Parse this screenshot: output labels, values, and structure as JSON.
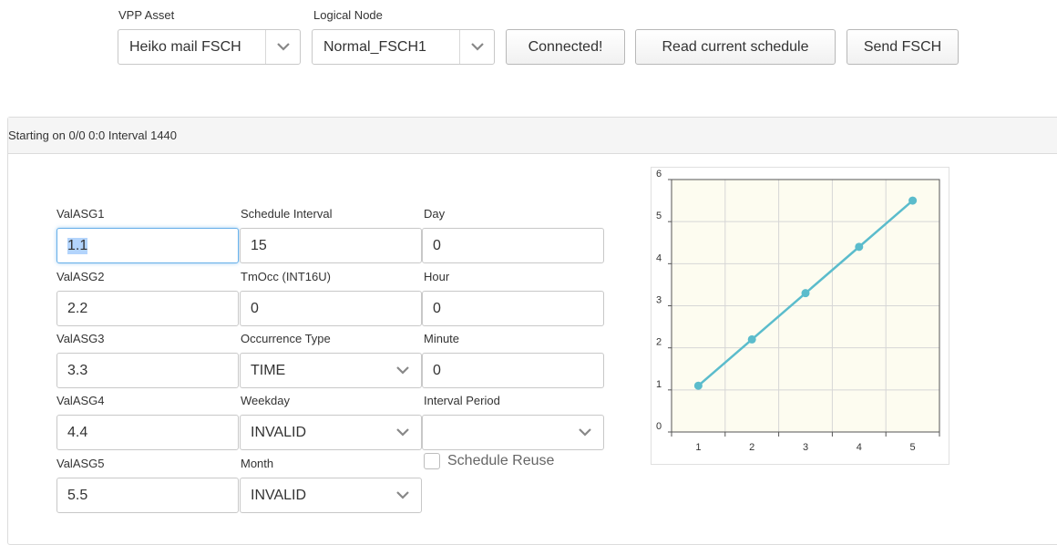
{
  "toolbar": {
    "vpp_asset_label": "VPP Asset",
    "vpp_asset_value": "Heiko mail FSCH",
    "logical_node_label": "Logical Node",
    "logical_node_value": "Normal_FSCH1",
    "connected_label": "Connected!",
    "read_schedule_label": "Read current schedule",
    "send_label": "Send FSCH"
  },
  "panel": {
    "heading": "Starting on 0/0 0:0 Interval 1440"
  },
  "form": {
    "val1_label": "ValASG1",
    "val1_value": "1.1",
    "val2_label": "ValASG2",
    "val2_value": "2.2",
    "val3_label": "ValASG3",
    "val3_value": "3.3",
    "val4_label": "ValASG4",
    "val4_value": "4.4",
    "val5_label": "ValASG5",
    "val5_value": "5.5",
    "sched_interval_label": "Schedule Interval",
    "sched_interval_value": "15",
    "tmocc_label": "TmOcc (INT16U)",
    "tmocc_value": "0",
    "occ_type_label": "Occurrence Type",
    "occ_type_value": "TIME",
    "weekday_label": "Weekday",
    "weekday_value": "INVALID",
    "month_label": "Month",
    "month_value": "INVALID",
    "day_label": "Day",
    "day_value": "0",
    "hour_label": "Hour",
    "hour_value": "0",
    "minute_label": "Minute",
    "minute_value": "0",
    "interval_period_label": "Interval Period",
    "interval_period_value": "",
    "schedule_reuse_label": "Schedule Reuse",
    "schedule_reuse_checked": false
  },
  "colors": {
    "line": "#5bbccc",
    "plot_bg": "#fdfcf0",
    "focus": "#66afe9"
  },
  "icons": {
    "caret": "chevron-down-icon",
    "checkbox": "checkbox-icon"
  },
  "chart_data": {
    "type": "line",
    "x": [
      1,
      2,
      3,
      4,
      5
    ],
    "series": [
      {
        "values": [
          1.1,
          2.2,
          3.3,
          4.4,
          5.5
        ]
      }
    ],
    "xticks": [
      "1",
      "2",
      "3",
      "4",
      "5"
    ],
    "yticks": [
      "0",
      "1",
      "2",
      "3",
      "4",
      "5",
      "6"
    ],
    "xlim": [
      0.5,
      5.5
    ],
    "ylim": [
      0,
      6
    ],
    "grid": true,
    "title": "",
    "xlabel": "",
    "ylabel": ""
  }
}
